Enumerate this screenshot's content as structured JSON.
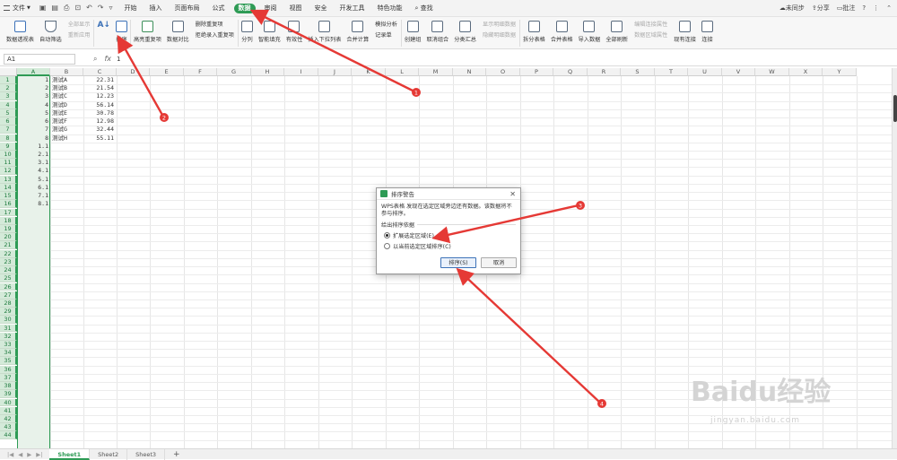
{
  "menu": {
    "file_label": "文件",
    "tabs": [
      "开始",
      "插入",
      "页面布局",
      "公式",
      "数据",
      "审阅",
      "视图",
      "安全",
      "开发工具",
      "特色功能"
    ],
    "active_tab": "数据",
    "search_label": "查找",
    "right": {
      "sync": "未同步",
      "share": "分享",
      "comment": "批注"
    }
  },
  "ribbon": {
    "pivot": "数据透视表",
    "autofilter": "自动筛选",
    "showall": "全部显示",
    "reapply": "重新应用",
    "sort_asc_label": "A↓",
    "sort": "排序",
    "highlight_dup": "高亮重复项",
    "compare": "数据对比",
    "delete_dup": "删除重复项",
    "reject_dup": "拒绝录入重复项",
    "split": "分列",
    "fill": "智能填充",
    "validity": "有效性",
    "insert_dropdown": "插入下拉列表",
    "consolidate": "合并计算",
    "simulate": "模拟分析",
    "record": "记录单",
    "create_group": "创建组",
    "ungroup": "取消组合",
    "subtotal": "分类汇总",
    "show_detail": "显示明细数据",
    "hide_detail": "隐藏明细数据",
    "split_table": "拆分表格",
    "merge_table": "合并表格",
    "import": "导入数据",
    "refresh_all": "全部刷新",
    "edit_link": "编辑连接属性",
    "data_area": "数据区域属性",
    "existing_conn": "现有连接",
    "connection": "连接"
  },
  "formula_bar": {
    "cell_ref": "A1",
    "fx": "fx",
    "value": "1"
  },
  "columns": [
    "A",
    "B",
    "C",
    "D",
    "E",
    "F",
    "G",
    "H",
    "I",
    "J",
    "K",
    "L",
    "M",
    "N",
    "O",
    "P",
    "Q",
    "R",
    "S",
    "T",
    "U",
    "V",
    "W",
    "X",
    "Y"
  ],
  "rows": [
    "1",
    "2",
    "3",
    "4",
    "5",
    "6",
    "7",
    "8",
    "9",
    "10",
    "11",
    "12",
    "13",
    "14",
    "15",
    "16",
    "17",
    "18",
    "19",
    "20",
    "21",
    "22",
    "23",
    "24",
    "25",
    "26",
    "27",
    "28",
    "29",
    "30",
    "31",
    "32",
    "33",
    "34",
    "35",
    "36",
    "37",
    "38",
    "39",
    "40",
    "41",
    "42",
    "43",
    "44"
  ],
  "col_a": [
    "1",
    "2",
    "3",
    "4",
    "5",
    "6",
    "7",
    "8",
    "1.1",
    "2.1",
    "3.1",
    "4.1",
    "5.1",
    "6.1",
    "7.1",
    "8.1"
  ],
  "col_b": [
    "测试A",
    "测试B",
    "测试C",
    "测试D",
    "测试E",
    "测试F",
    "测试G",
    "测试H"
  ],
  "col_c": [
    "22.31",
    "21.54",
    "12.23",
    "56.14",
    "30.78",
    "12.98",
    "32.44",
    "55.11"
  ],
  "dialog": {
    "title": "排序警告",
    "message": "WPS表格 发现在选定区域旁边还有数据。该数据将不参与排序。",
    "group_label": "给出排序依据",
    "option1": "扩展选定区域(E)",
    "option2": "以当前选定区域排序(C)",
    "selected_option": 1,
    "ok": "排序(S)",
    "cancel": "取消"
  },
  "sheets": [
    "Sheet1",
    "Sheet2",
    "Sheet3"
  ],
  "active_sheet": "Sheet1",
  "add_sheet": "+",
  "annotations": [
    "1",
    "2",
    "3",
    "4"
  ],
  "watermark": {
    "brand": "Baidu经验",
    "url": "jingyan.baidu.com"
  },
  "colors": {
    "accent": "#2e9b55",
    "arrow": "#e53935"
  }
}
